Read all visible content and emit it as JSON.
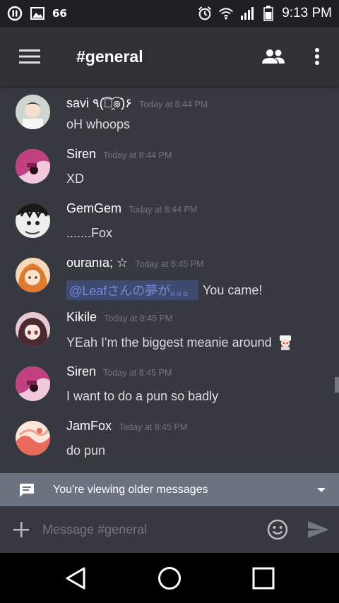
{
  "status_bar": {
    "battery_percent": "66",
    "time": "9:13 PM",
    "icons": [
      "pause-circle-icon",
      "image-icon",
      "alarm-icon",
      "wifi-icon",
      "signal-icon",
      "battery-icon"
    ]
  },
  "app_bar": {
    "channel_name": "#general",
    "icons": [
      "hamburger-menu-icon",
      "members-icon",
      "overflow-menu-icon"
    ]
  },
  "messages": [
    {
      "user": "savi ٩(͡๏̯͡๏)۶",
      "time": "Today at 8:44 PM",
      "text": "oH whoops",
      "avatar_color": "#d8d2c5"
    },
    {
      "user": "Siren",
      "time": "Today at 8:44 PM",
      "text": "XD",
      "avatar_color": "#e8a6c8"
    },
    {
      "user": "GemGem",
      "time": "Today at 8:44 PM",
      "text": ".......Fox",
      "avatar_color": "#e6e6e6"
    },
    {
      "user": "ouranıa; ☆",
      "time": "Today at 8:45 PM",
      "mention": "@Leafさんの夢が。。。",
      "text": "You came!",
      "avatar_color": "#f0b27a"
    },
    {
      "user": "Kikile",
      "time": "Today at 8:45 PM",
      "text": "YEah I'm the biggest meanie around",
      "avatar_color": "#d9b3c0"
    },
    {
      "user": "Siren",
      "time": "Today at 8:45 PM",
      "text": "I want to do a pun so badly",
      "avatar_color": "#e8a6c8"
    },
    {
      "user": "JamFox",
      "time": "Today at 8:45 PM",
      "text": "do pun",
      "avatar_color": "#f2b59a"
    }
  ],
  "older_banner": {
    "text": "You're viewing older messages"
  },
  "composer": {
    "placeholder": "Message #general"
  },
  "nav_bar": {
    "icons": [
      "back-icon",
      "home-icon",
      "recents-icon"
    ]
  },
  "colors": {
    "background": "#36393f",
    "app_bar": "#2f3136",
    "mention": "#7289da",
    "banner": "#6b7280"
  }
}
